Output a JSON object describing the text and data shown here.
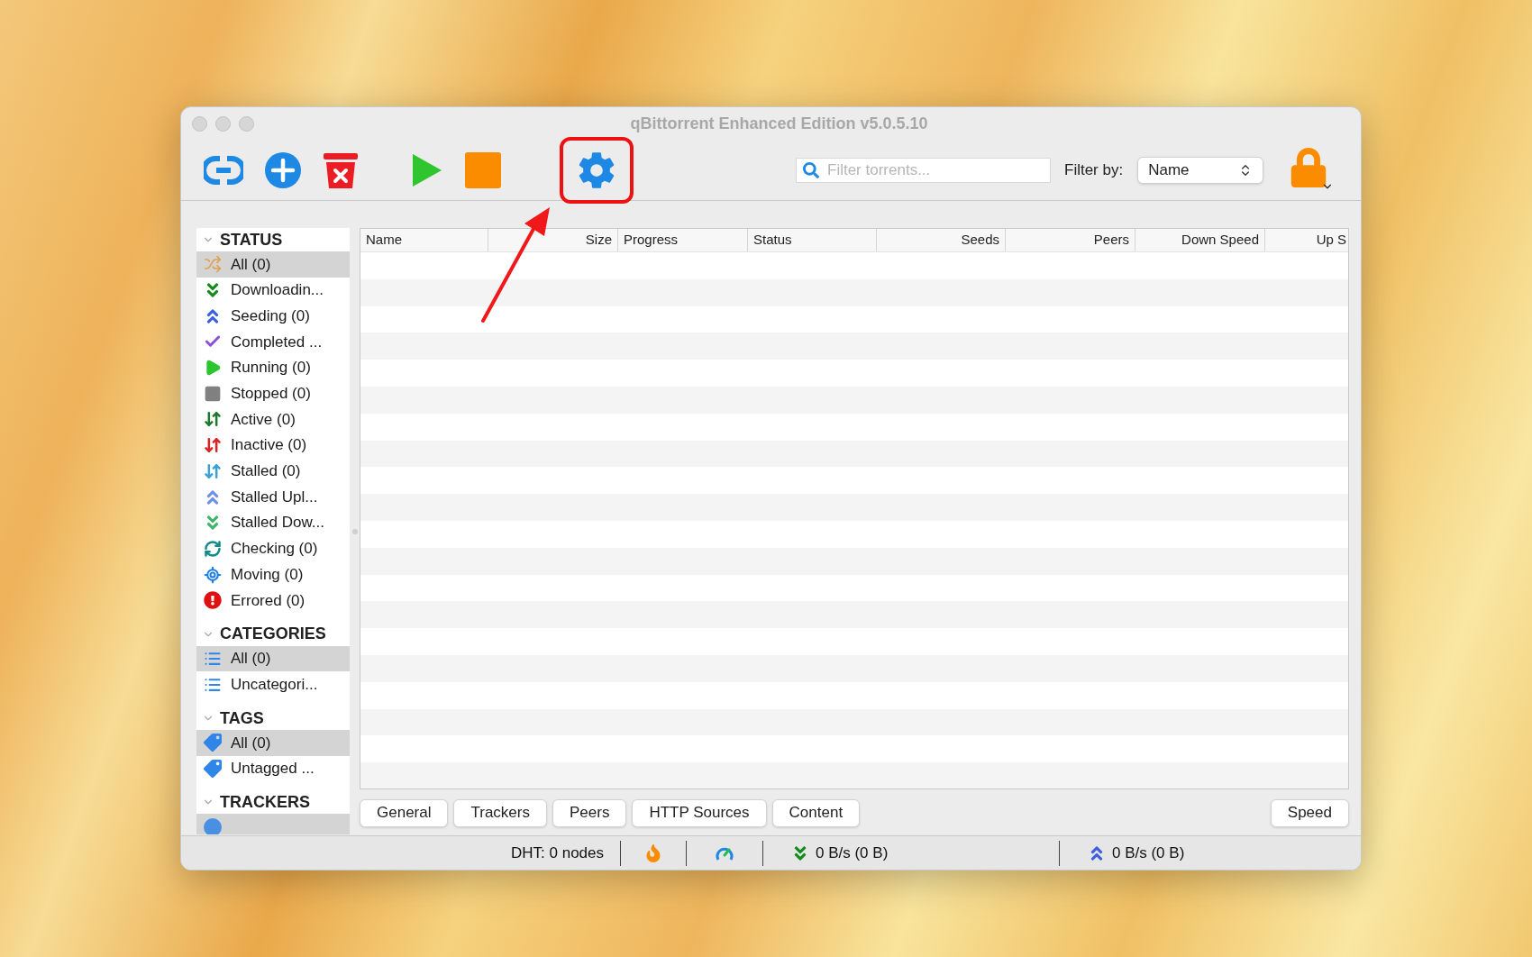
{
  "window": {
    "title": "qBittorrent Enhanced Edition v5.0.5.10"
  },
  "toolbar": {
    "search": {
      "placeholder": "Filter torrents..."
    },
    "filter_label": "Filter by:",
    "filter_select": {
      "value": "Name"
    }
  },
  "sidebar": {
    "sections": [
      {
        "title": "STATUS",
        "expanded": true,
        "items": [
          {
            "kind": "all",
            "label": "All (0)",
            "selected": true
          },
          {
            "kind": "downloading",
            "label": "Downloadin...",
            "selected": false
          },
          {
            "kind": "seeding",
            "label": "Seeding (0)",
            "selected": false
          },
          {
            "kind": "completed",
            "label": "Completed ...",
            "selected": false
          },
          {
            "kind": "running",
            "label": "Running (0)",
            "selected": false
          },
          {
            "kind": "stopped",
            "label": "Stopped (0)",
            "selected": false
          },
          {
            "kind": "active",
            "label": "Active (0)",
            "selected": false
          },
          {
            "kind": "inactive",
            "label": "Inactive (0)",
            "selected": false
          },
          {
            "kind": "stalled",
            "label": "Stalled (0)",
            "selected": false
          },
          {
            "kind": "stalled_up",
            "label": "Stalled Upl...",
            "selected": false
          },
          {
            "kind": "stalled_down",
            "label": "Stalled Dow...",
            "selected": false
          },
          {
            "kind": "checking",
            "label": "Checking (0)",
            "selected": false
          },
          {
            "kind": "moving",
            "label": "Moving (0)",
            "selected": false
          },
          {
            "kind": "errored",
            "label": "Errored (0)",
            "selected": false
          }
        ]
      },
      {
        "title": "CATEGORIES",
        "expanded": true,
        "items": [
          {
            "kind": "category",
            "label": "All (0)",
            "selected": true
          },
          {
            "kind": "category",
            "label": "Uncategori...",
            "selected": false
          }
        ]
      },
      {
        "title": "TAGS",
        "expanded": true,
        "items": [
          {
            "kind": "tag",
            "label": "All (0)",
            "selected": true
          },
          {
            "kind": "tag",
            "label": "Untagged ...",
            "selected": false
          }
        ]
      },
      {
        "title": "TRACKERS",
        "expanded": true,
        "items": [
          {
            "kind": "tracker",
            "selected": true
          }
        ]
      }
    ]
  },
  "table": {
    "columns": [
      {
        "label": "Name"
      },
      {
        "label": "Size"
      },
      {
        "label": "Progress"
      },
      {
        "label": "Status"
      },
      {
        "label": "Seeds"
      },
      {
        "label": "Peers"
      },
      {
        "label": "Down Speed"
      },
      {
        "label": "Up S"
      }
    ]
  },
  "detail_tabs": [
    "General",
    "Trackers",
    "Peers",
    "HTTP Sources",
    "Content"
  ],
  "speed_button": "Speed",
  "status_bar": {
    "dht": "DHT: 0 nodes",
    "download": "0 B/s (0 B)",
    "upload": "0 B/s (0 B)"
  }
}
